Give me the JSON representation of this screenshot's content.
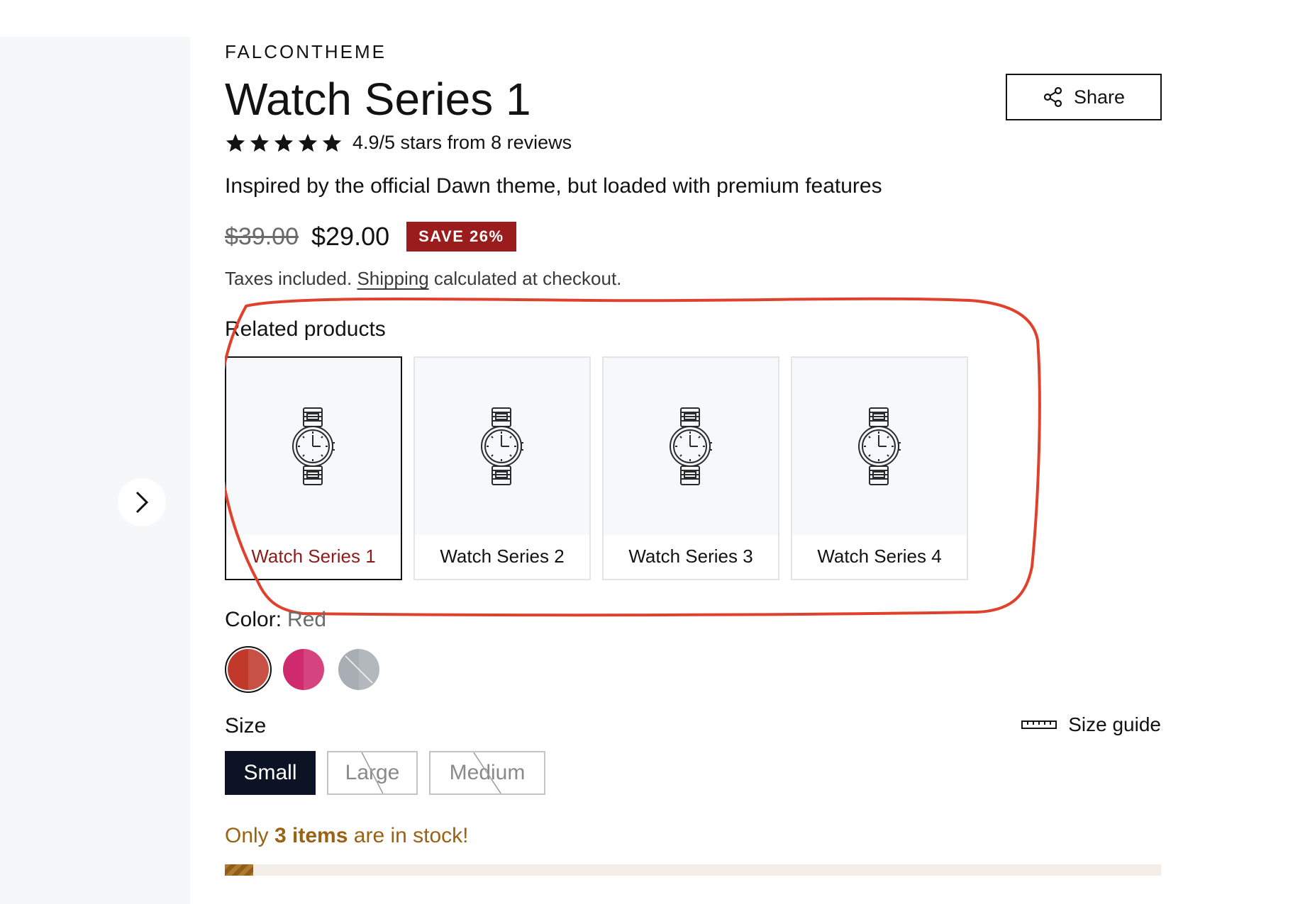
{
  "gallery": {
    "next_icon": "chevron-right-icon"
  },
  "product": {
    "vendor": "FALCONTHEME",
    "title": "Watch Series 1",
    "share_label": "Share",
    "share_icon": "share-icon",
    "rating": {
      "stars": 5,
      "text": "4.9/5 stars from 8 reviews"
    },
    "tagline": "Inspired by the official Dawn theme, but loaded with premium features",
    "price": {
      "compare_at": "$39.00",
      "sale": "$29.00",
      "badge": "SAVE 26%",
      "badge_color": "#9b1c1c"
    },
    "tax_note": {
      "prefix": "Taxes included.",
      "link": "Shipping",
      "suffix": "calculated at checkout."
    }
  },
  "related": {
    "title": "Related products",
    "items": [
      {
        "label": "Watch Series 1",
        "selected": true
      },
      {
        "label": "Watch Series 2",
        "selected": false
      },
      {
        "label": "Watch Series 3",
        "selected": false
      },
      {
        "label": "Watch Series 4",
        "selected": false
      }
    ],
    "annotation_color": "#e0412c"
  },
  "color": {
    "label": "Color:",
    "value": "Red",
    "swatches": [
      {
        "name": "Red",
        "hex": "#c0392b",
        "selected": true,
        "available": true
      },
      {
        "name": "Pink",
        "hex": "#cf2a6e",
        "selected": false,
        "available": true
      },
      {
        "name": "Gray",
        "hex": "#9aa0a6",
        "selected": false,
        "available": false
      }
    ]
  },
  "size": {
    "label": "Size",
    "guide_label": "Size guide",
    "guide_icon": "ruler-icon",
    "options": [
      {
        "label": "Small",
        "selected": true,
        "available": true
      },
      {
        "label": "Large",
        "selected": false,
        "available": false
      },
      {
        "label": "Medium",
        "selected": false,
        "available": false
      }
    ]
  },
  "stock": {
    "prefix": "Only",
    "count": "3 items",
    "suffix": "are in stock!",
    "level": 0.03,
    "color": "#9a6213"
  }
}
